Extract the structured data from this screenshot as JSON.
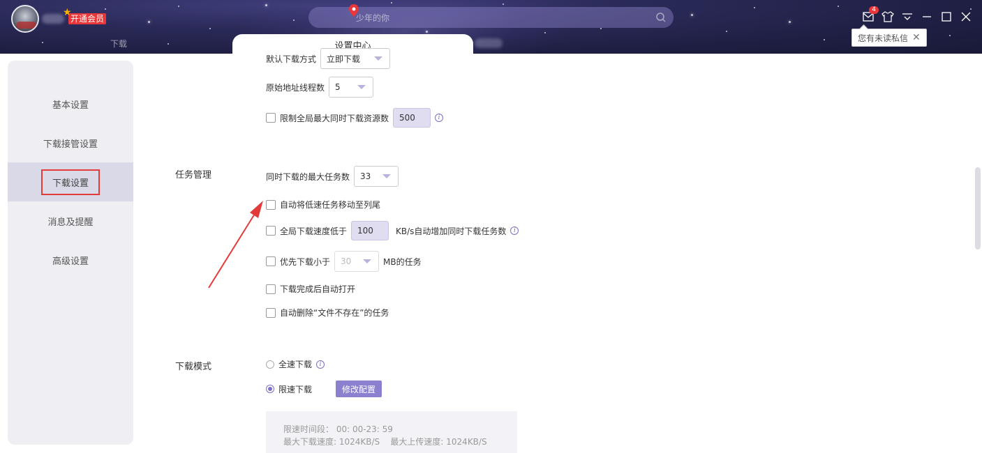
{
  "header": {
    "vip_label": "开通会员",
    "search_placeholder": "少年的你",
    "mail_badge_count": "4",
    "tooltip_text": "您有未读私信"
  },
  "tabs": {
    "download": "下载",
    "settings": "设置中心"
  },
  "sidebar": {
    "items": [
      {
        "label": "基本设置"
      },
      {
        "label": "下载接管设置"
      },
      {
        "label": "下载设置",
        "active": true
      },
      {
        "label": "消息及提醒"
      },
      {
        "label": "高级设置"
      }
    ]
  },
  "top_rows": {
    "download_mode_label": "默认下载方式",
    "download_mode_value": "立即下载",
    "origin_threads_label": "原始地址线程数",
    "origin_threads_value": "5",
    "limit_global_label": "限制全局最大同时下载资源数",
    "limit_global_value": "500"
  },
  "task_management": {
    "title": "任务管理",
    "max_tasks_label": "同时下载的最大任务数",
    "max_tasks_value": "33",
    "auto_move_slow": "自动将低速任务移动至列尾",
    "speed_below_label": "全局下载速度低于",
    "speed_below_value": "100",
    "speed_below_suffix": "KB/s自动增加同时下载任务数",
    "prefer_small_label": "优先下载小于",
    "prefer_small_value": "30",
    "prefer_small_suffix": "MB的任务",
    "auto_open": "下载完成后自动打开",
    "auto_delete": "自动删除“文件不存在”的任务"
  },
  "download_mode": {
    "title": "下载模式",
    "full_speed": "全速下载",
    "limited_speed": "限速下载",
    "modify_btn": "修改配置",
    "time_range": "限速时间段： 00: 00-23: 59",
    "max_speeds": "最大下载速度: 1024KB/S    最大上传速度: 1024KB/S"
  },
  "colors": {
    "accent": "#8b7fd0",
    "highlight_box": "#e33a3a",
    "vip_red": "#e8373a"
  }
}
